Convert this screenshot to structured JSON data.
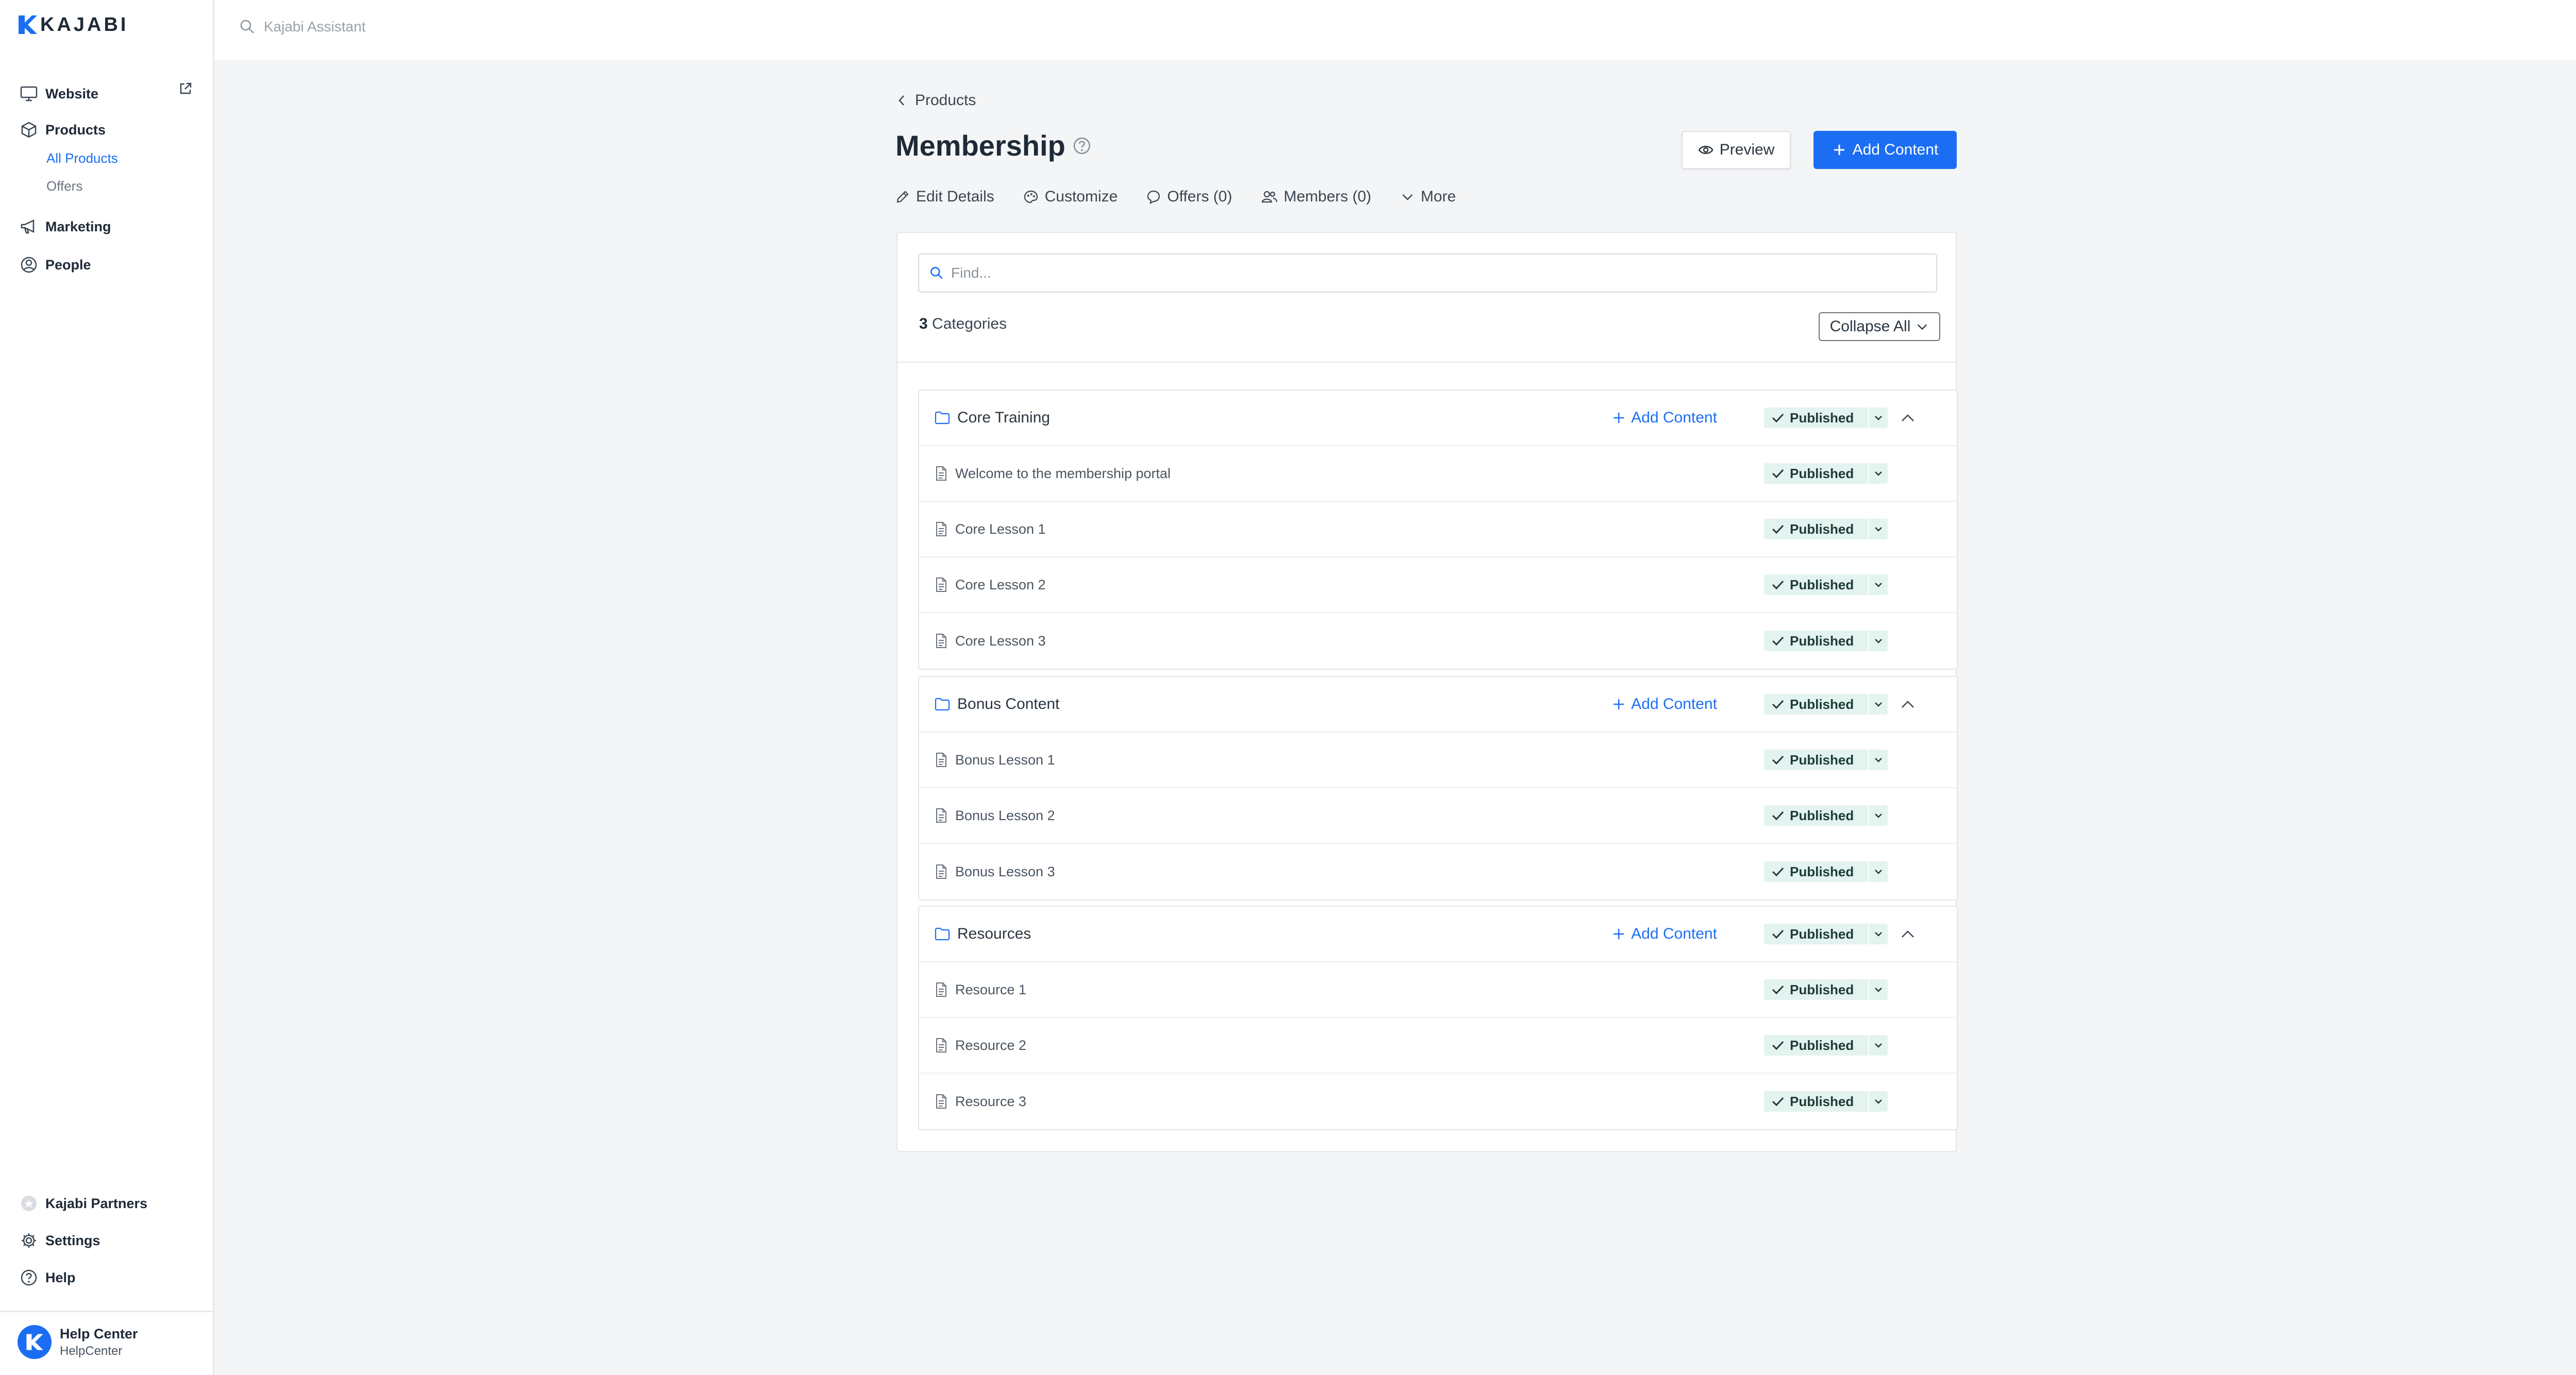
{
  "brand": {
    "name": "KAJABI"
  },
  "colors": {
    "accent": "#1b6ef3",
    "published_bg": "#e3f3ef"
  },
  "sidebar": {
    "items": [
      {
        "label": "Website",
        "icon": "monitor-icon"
      },
      {
        "label": "Products",
        "icon": "cube-icon"
      },
      {
        "label": "Marketing",
        "icon": "megaphone-icon"
      },
      {
        "label": "People",
        "icon": "user-circle-icon"
      }
    ],
    "products_sub": [
      "All Products",
      "Offers"
    ],
    "bottom": [
      {
        "label": "Kajabi Partners",
        "icon": "partners-icon"
      },
      {
        "label": "Settings",
        "icon": "gear-icon"
      },
      {
        "label": "Help",
        "icon": "help-icon"
      }
    ],
    "account": {
      "name": "Help Center",
      "sub": "HelpCenter"
    }
  },
  "topbar": {
    "search_placeholder": "Kajabi Assistant"
  },
  "page": {
    "back_label": "Products",
    "title": "Membership",
    "preview_label": "Preview",
    "add_content_label": "Add Content",
    "tabs": [
      "Edit Details",
      "Customize",
      "Offers (0)",
      "Members (0)",
      "More"
    ]
  },
  "content": {
    "find_placeholder": "Find...",
    "category_count": "3",
    "category_count_label": "Categories",
    "collapse_label": "Collapse All",
    "add_content_label": "Add Content",
    "status_label": "Published",
    "categories": [
      {
        "name": "Core Training",
        "lessons": [
          "Welcome to the membership portal",
          "Core Lesson 1",
          "Core Lesson 2",
          "Core Lesson 3"
        ]
      },
      {
        "name": "Bonus Content",
        "lessons": [
          "Bonus Lesson 1",
          "Bonus Lesson 2",
          "Bonus Lesson 3"
        ]
      },
      {
        "name": "Resources",
        "lessons": [
          "Resource 1",
          "Resource 2",
          "Resource 3"
        ]
      }
    ]
  }
}
